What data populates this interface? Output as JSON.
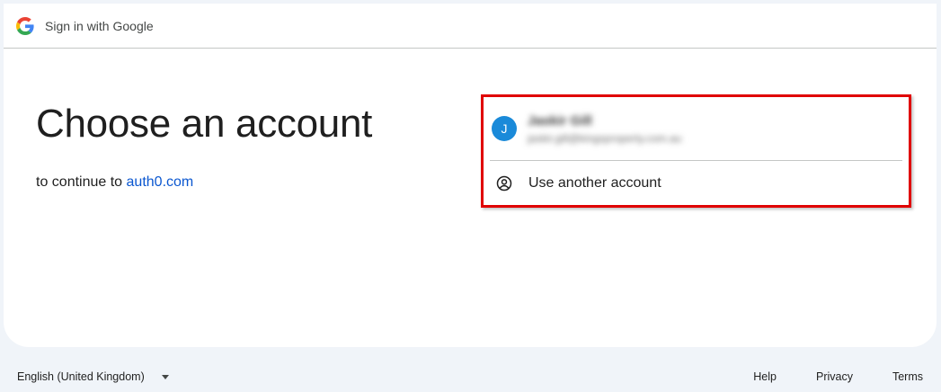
{
  "header": {
    "title": "Sign in with Google",
    "logo_icon": "google-g-logo"
  },
  "main": {
    "title": "Choose an account",
    "subtitle_prefix": "to continue to",
    "subtitle_link": "auth0.com",
    "link_color": "#0b57d0"
  },
  "accounts": {
    "list": [
      {
        "avatar_letter": "J",
        "avatar_color": "#1a8ad9",
        "name": "Jaskir Gill",
        "email": "jaskir.gill@kingsproperty.com.au"
      }
    ],
    "use_another_label": "Use another account",
    "use_another_icon": "person-circle-icon",
    "highlight_color": "#e00000"
  },
  "footer": {
    "language": "English (United Kingdom)",
    "links": [
      "Help",
      "Privacy",
      "Terms"
    ]
  }
}
